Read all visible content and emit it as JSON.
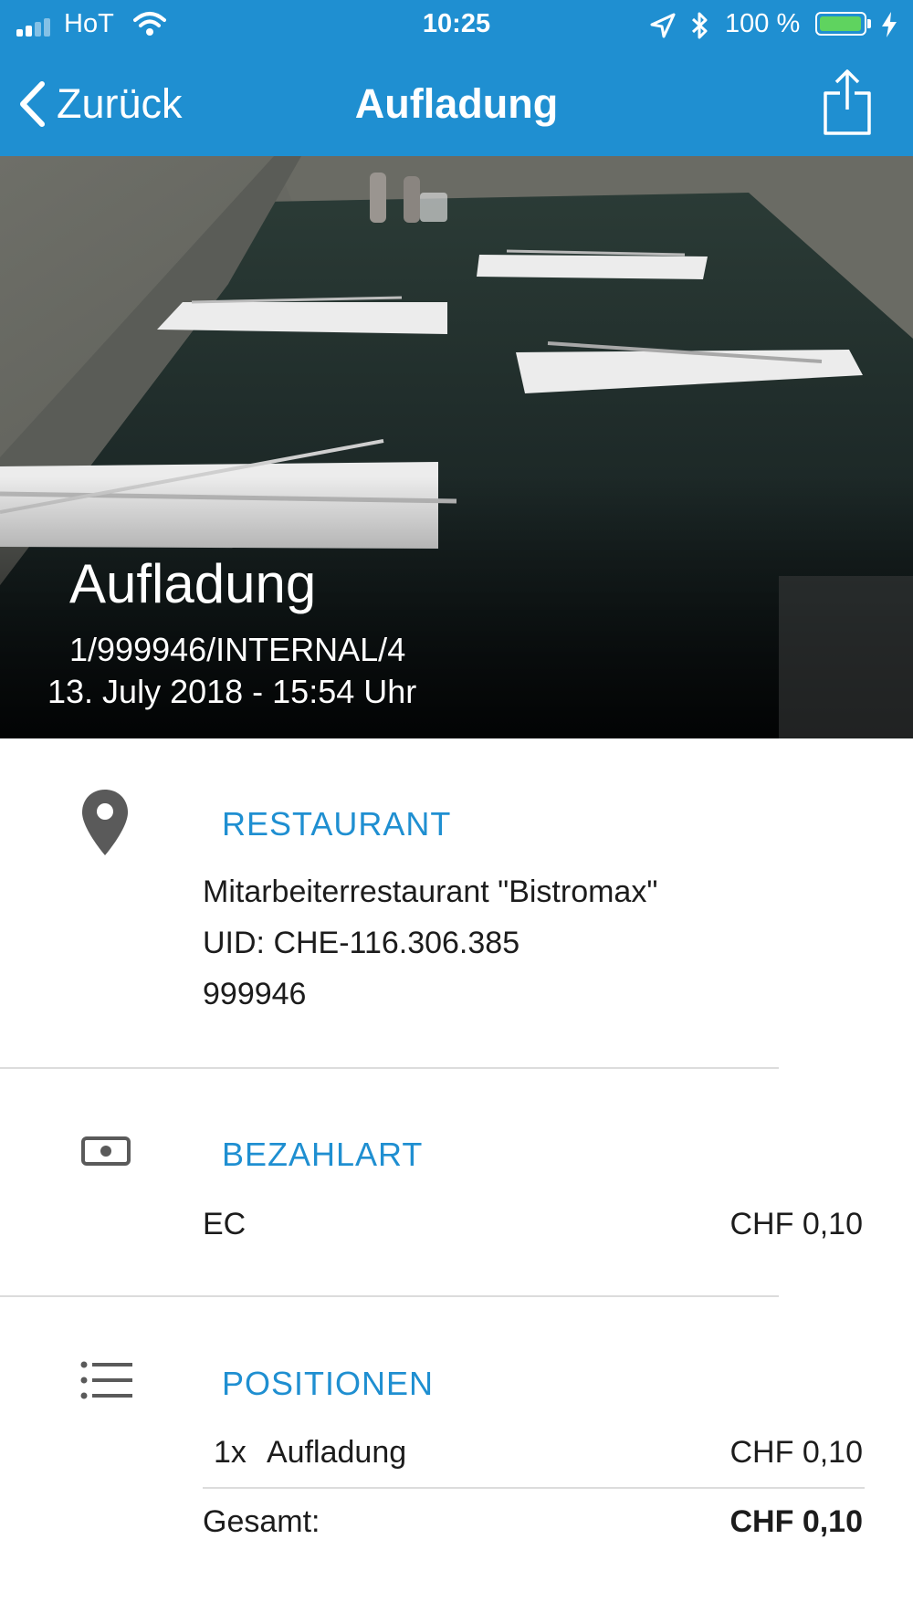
{
  "status_bar": {
    "carrier": "HoT",
    "time": "10:25",
    "battery_percent": "100 %",
    "battery_level": 1.0,
    "signal_bars": 2
  },
  "nav": {
    "back_label": "Zurück",
    "title": "Aufladung",
    "share_icon": "share-icon"
  },
  "hero": {
    "title": "Aufladung",
    "reference": "1/999946/INTERNAL/4",
    "datetime": "13. July 2018 - 15:54 Uhr"
  },
  "restaurant": {
    "heading": "RESTAURANT",
    "icon": "location-pin-icon",
    "name": "Mitarbeiterrestaurant \"Bistromax\"",
    "uid": "UID: CHE-116.306.385",
    "number": "999946"
  },
  "payment": {
    "heading": "BEZAHLART",
    "icon": "cash-icon",
    "method": "EC",
    "amount": "CHF 0,10"
  },
  "positions": {
    "heading": "POSITIONEN",
    "icon": "list-icon",
    "items": [
      {
        "quantity": "1x",
        "label": "Aufladung",
        "amount": "CHF 0,10"
      }
    ],
    "total_label": "Gesamt:",
    "total_amount": "CHF 0,10"
  },
  "colors": {
    "accent": "#1f8fd1",
    "battery": "#5fd35f"
  }
}
